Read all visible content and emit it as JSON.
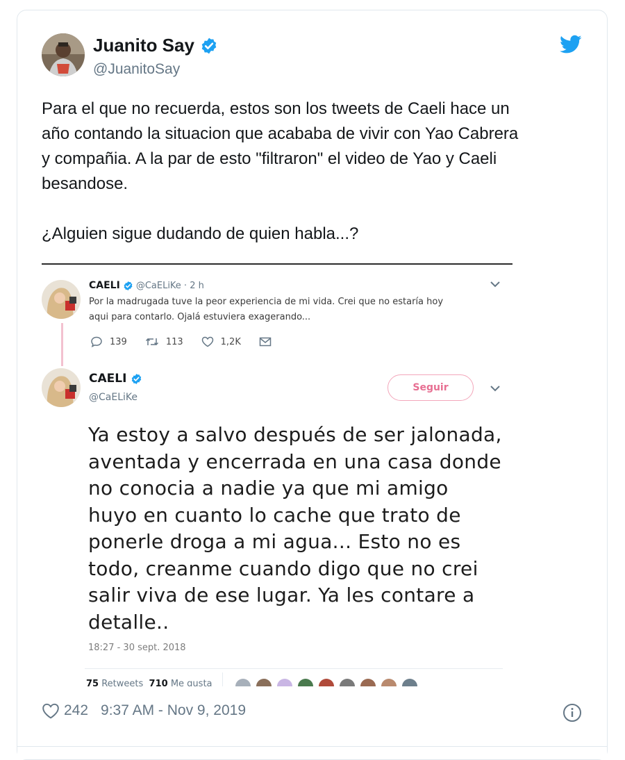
{
  "author": {
    "name": "Juanito Say",
    "handle": "@JuanitoSay"
  },
  "tweet": {
    "text": "Para el que no recuerda, estos son los tweets de Caeli hace un\naño contando la situacion que acababa de vivir con Yao Cabrera\ny compañia. A la par de esto \"filtraron\" el video de Yao y Caeli\nbesandose.\n\n¿Alguien sigue dudando de quien habla...?"
  },
  "screenshot": {
    "quoted": {
      "name": "CAELI",
      "meta": "@CaELiKe · 2 h",
      "text": "Por la madrugada tuve la peor experiencia de mi vida. Crei que no estaría hoy\naqui para contarlo. Ojalá estuviera exagerando...",
      "replies": "139",
      "retweets": "113",
      "likes": "1,2K"
    },
    "main": {
      "name": "CAELI",
      "handle": "@CaELiKe",
      "follow_label": "Seguir",
      "text": "Ya estoy a salvo después de ser jalonada,\naventada y encerrada en una casa donde\nno conocia a nadie ya que mi amigo\nhuyo en cuanto lo cache que trato de\nponerle droga a mi agua... Esto no es\ntodo, creanme cuando digo que no crei\nsalir viva de ese lugar. Ya les contare a\ndetalle..",
      "timestamp": "18:27 - 30 sept. 2018",
      "retweets_count": "75",
      "retweets_label": "Retweets",
      "likes_count": "710",
      "likes_label": "Me gusta"
    }
  },
  "footer": {
    "likes": "242",
    "time": "9:37 AM - Nov 9, 2019"
  },
  "colors": {
    "accent": "#1da1f2",
    "verified": "#1da1f2",
    "follow_pink": "#e76f92"
  },
  "icons": [
    "verified-badge-icon",
    "twitter-bird-icon",
    "reply-icon",
    "retweet-icon",
    "heart-icon",
    "message-icon",
    "chevron-down-icon",
    "info-icon"
  ]
}
